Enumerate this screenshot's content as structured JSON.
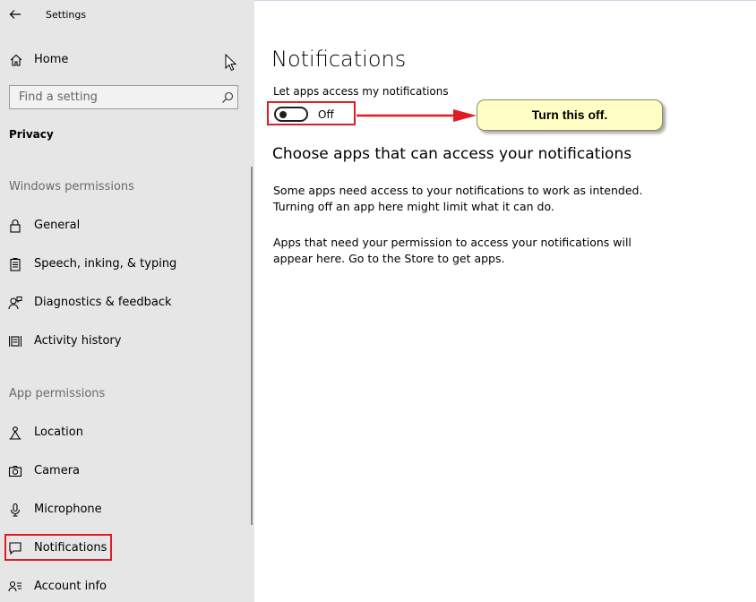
{
  "window": {
    "title": "Settings"
  },
  "sidebar": {
    "home_label": "Home",
    "search": {
      "placeholder": "Find a setting"
    },
    "category": "Privacy",
    "sections": {
      "windows_permissions": "Windows permissions",
      "app_permissions": "App permissions"
    },
    "windows_items": [
      {
        "label": "General",
        "icon": "lock-icon"
      },
      {
        "label": "Speech, inking, & typing",
        "icon": "clipboard-icon"
      },
      {
        "label": "Diagnostics & feedback",
        "icon": "person-feedback-icon"
      },
      {
        "label": "Activity history",
        "icon": "timeline-icon"
      }
    ],
    "app_items": [
      {
        "label": "Location",
        "icon": "location-icon"
      },
      {
        "label": "Camera",
        "icon": "camera-icon"
      },
      {
        "label": "Microphone",
        "icon": "microphone-icon"
      },
      {
        "label": "Notifications",
        "icon": "notification-icon",
        "selected": true
      },
      {
        "label": "Account info",
        "icon": "account-info-icon"
      }
    ]
  },
  "main": {
    "title": "Notifications",
    "toggle": {
      "label": "Let apps access my notifications",
      "state": "Off"
    },
    "callout": "Turn this off.",
    "subheading": "Choose apps that can access your notifications",
    "paragraphs": [
      {
        "line1": "Some apps need access to your notifications to work as intended.",
        "line2": "Turning off an app here might limit what it can do."
      },
      {
        "line1": "Apps that need your permission to access your notifications will",
        "line2": "appear here. Go to the Store to get apps."
      }
    ]
  },
  "colors": {
    "annotation_red": "#e01b24",
    "callout_fill": "#fefec5",
    "sidebar_bg": "#e6e6e6"
  }
}
